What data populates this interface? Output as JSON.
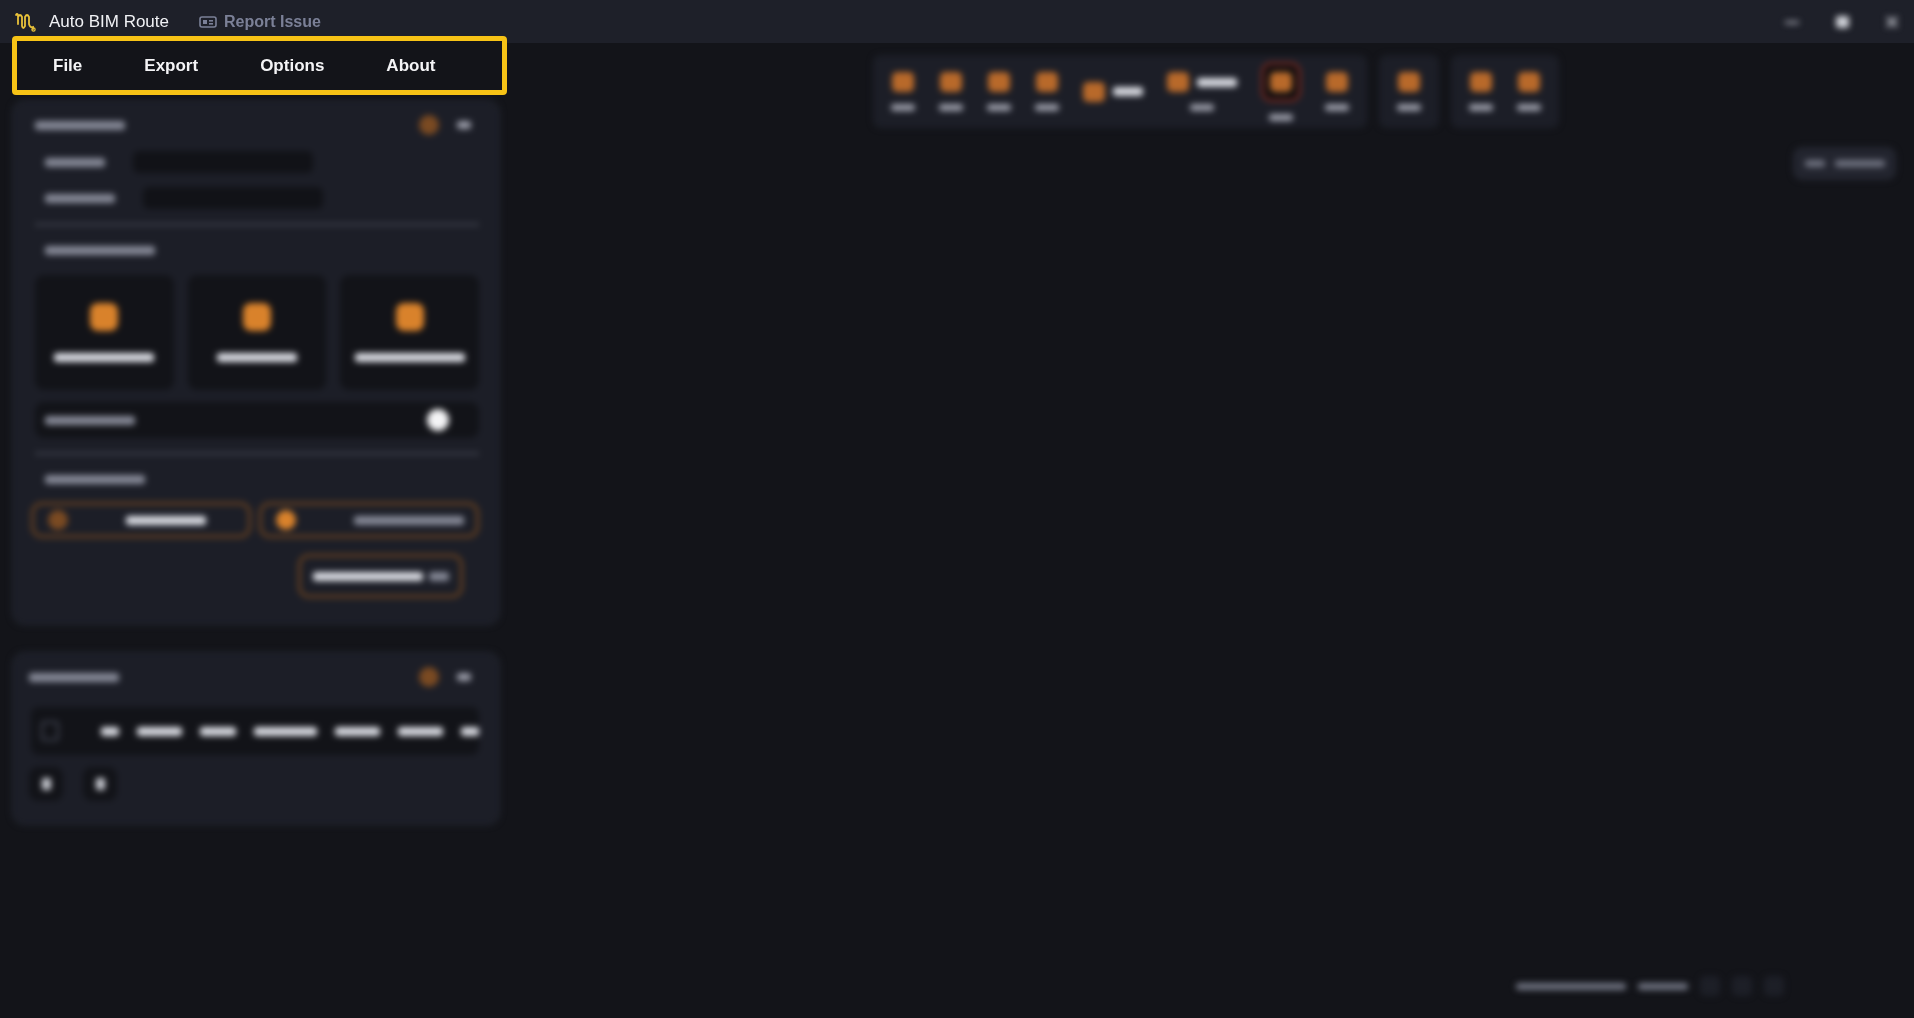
{
  "app": {
    "title": "Auto BIM Route",
    "report_link": "Report Issue"
  },
  "menu_bar": {
    "highlighted": true,
    "items": [
      "File",
      "Export",
      "Options",
      "About"
    ]
  },
  "workspace": {
    "blurred": true
  }
}
